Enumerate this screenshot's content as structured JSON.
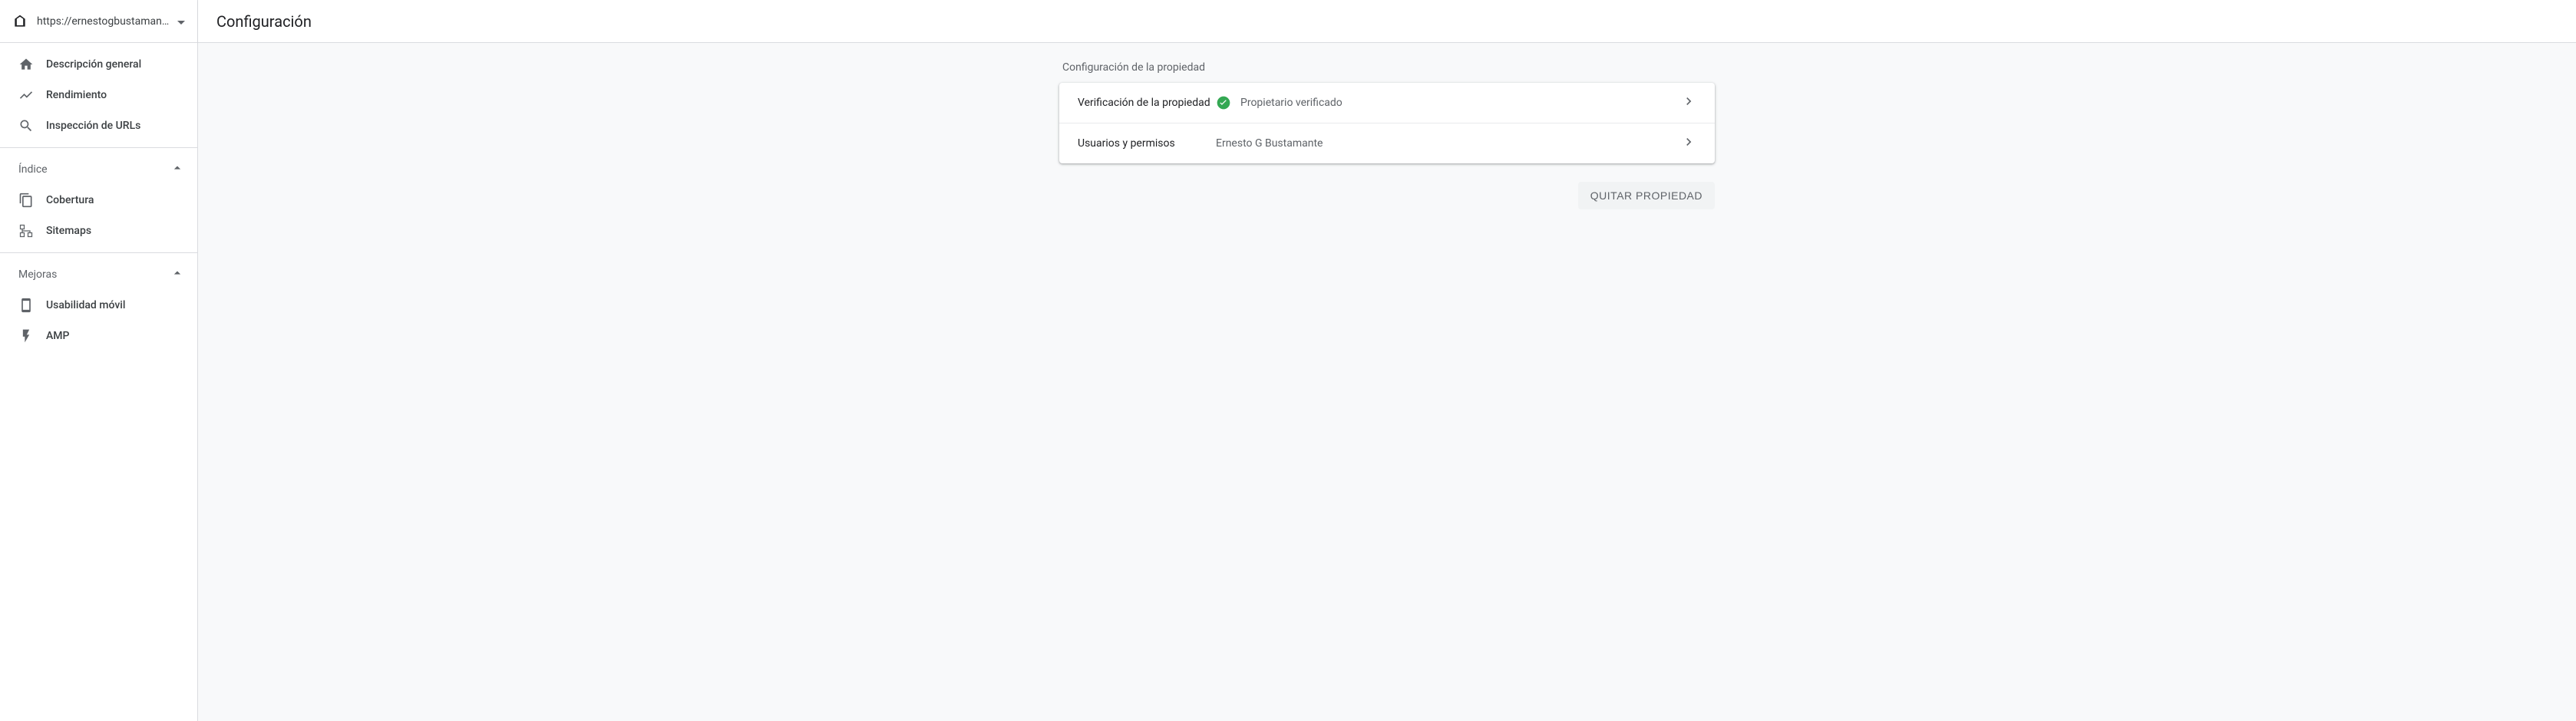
{
  "property": {
    "url": "https://ernestogbustamante...."
  },
  "sidebar": {
    "items": [
      {
        "label": "Descripción general"
      },
      {
        "label": "Rendimiento"
      },
      {
        "label": "Inspección de URLs"
      }
    ],
    "sections": [
      {
        "title": "Índice",
        "items": [
          {
            "label": "Cobertura"
          },
          {
            "label": "Sitemaps"
          }
        ]
      },
      {
        "title": "Mejoras",
        "items": [
          {
            "label": "Usabilidad móvil"
          },
          {
            "label": "AMP"
          }
        ]
      }
    ]
  },
  "header": {
    "title": "Configuración"
  },
  "settings": {
    "section_title": "Configuración de la propiedad",
    "verification": {
      "label": "Verificación de la propiedad",
      "status": "Propietario verificado"
    },
    "users": {
      "label": "Usuarios y permisos",
      "value": "Ernesto G Bustamante"
    },
    "remove_button": "QUITAR PROPIEDAD"
  }
}
